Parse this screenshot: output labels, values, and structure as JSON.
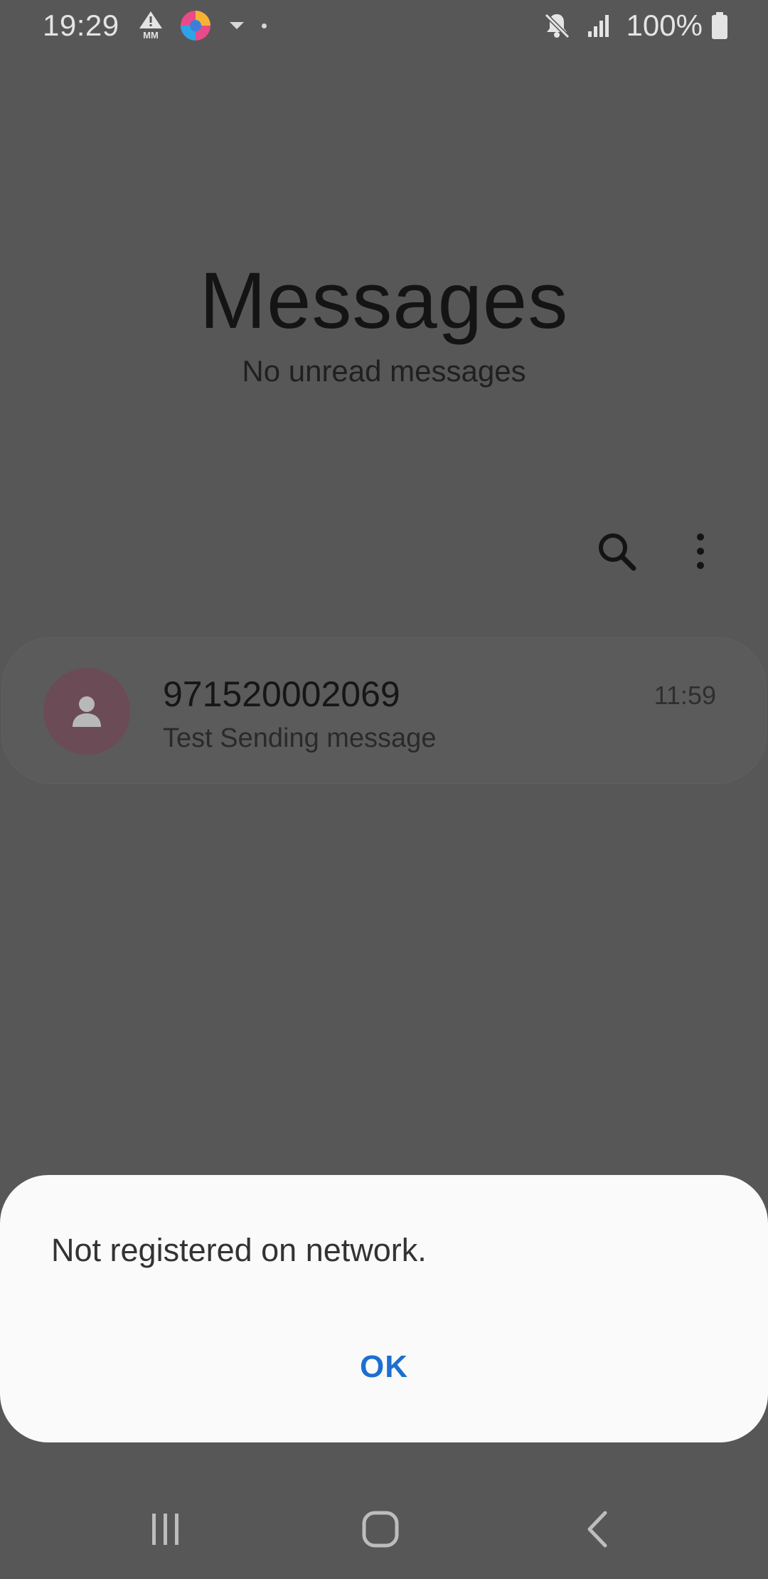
{
  "status_bar": {
    "time": "19:29",
    "warning_label": "MM",
    "battery_percent": "100%",
    "icons": [
      "warning-icon",
      "browser-app-icon",
      "download-arrow-icon",
      "dot-icon",
      "mute-icon",
      "signal-icon",
      "battery-icon"
    ]
  },
  "header": {
    "title": "Messages",
    "subtitle": "No unread messages"
  },
  "toolbar": {
    "icons": [
      "search-icon",
      "more-options-icon"
    ]
  },
  "conversations": [
    {
      "name": "971520002069",
      "preview": "Test Sending message",
      "time": "11:59",
      "avatar_color": "#6b4b56"
    }
  ],
  "dialog": {
    "message": "Not registered on network.",
    "ok_label": "OK",
    "accent_color": "#1c6fd0"
  },
  "nav_bar": {
    "icons": [
      "recents-icon",
      "home-icon",
      "back-icon"
    ]
  }
}
